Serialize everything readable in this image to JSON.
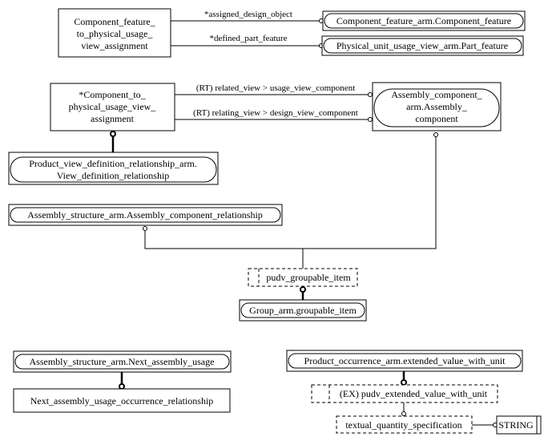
{
  "diagram": {
    "entities": {
      "cf_to_puv_assignment": [
        "Component_feature_",
        "to_physical_usage_",
        "view_assignment"
      ],
      "component_feature": "Component_feature_arm.Component_feature",
      "part_feature": "Physical_unit_usage_view_arm.Part_feature",
      "c_to_puv_assignment": [
        "*Component_to_",
        "physical_usage_view_",
        "assignment"
      ],
      "assembly_component": [
        "Assembly_component_",
        "arm.Assembly_",
        "component"
      ],
      "view_definition_relationship": [
        "Product_view_definition_relationship_arm.",
        "View_definition_relationship"
      ],
      "assembly_component_relationship": "Assembly_structure_arm.Assembly_component_relationship",
      "pudv_groupable_item": "pudv_groupable_item",
      "groupable_item": "Group_arm.groupable_item",
      "next_assembly_usage": "Assembly_structure_arm.Next_assembly_usage",
      "nauo_relationship": "Next_assembly_usage_occurrence_relationship",
      "extended_value_with_unit": "Product_occurrence_arm.extended_value_with_unit",
      "pudv_extended_value_with_unit": "(EX) pudv_extended_value_with_unit",
      "textual_quantity_specification": "textual_quantity_specification",
      "string_type": "STRING"
    },
    "relations": {
      "assigned_design_object": "*assigned_design_object",
      "defined_part_feature": "*defined_part_feature",
      "related_view": "(RT) related_view > usage_view_component",
      "relating_view": "(RT) relating_view > design_view_component"
    }
  }
}
